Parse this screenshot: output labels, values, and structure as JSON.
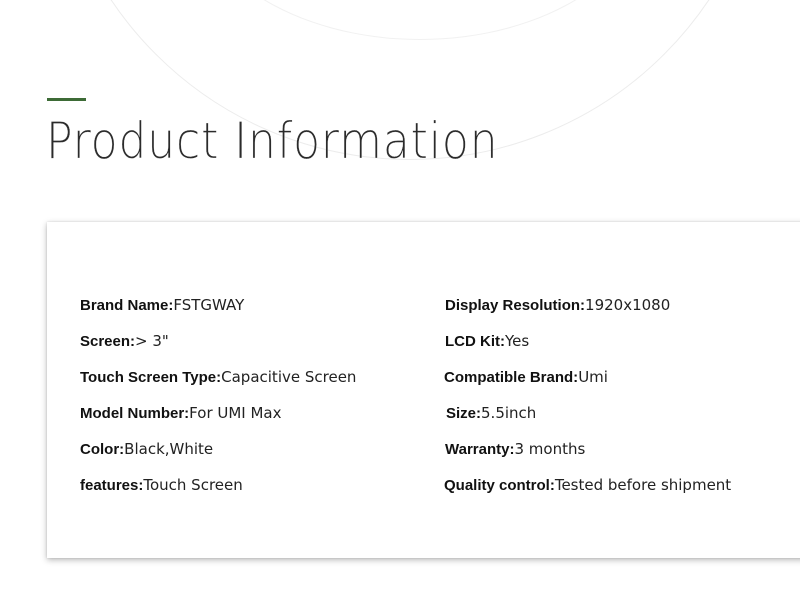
{
  "header": {
    "title": "Product Information",
    "accent_color": "#3d6b36"
  },
  "specs_left": [
    {
      "label": "Brand Name:",
      "value": "FSTGWAY"
    },
    {
      "label": "Screen:",
      "value": "> 3\""
    },
    {
      "label": "Touch Screen Type:",
      "value": "Capacitive Screen"
    },
    {
      "label": "Model Number:",
      "value": "For UMI Max"
    },
    {
      "label": "Color:",
      "value": "Black,White"
    },
    {
      "label": "features:",
      "value": "Touch Screen"
    }
  ],
  "specs_right": [
    {
      "label": "Display Resolution:",
      "value": "1920x1080"
    },
    {
      "label": "LCD Kit:",
      "value": "Yes"
    },
    {
      "label": "Compatible Brand:",
      "value": "Umi"
    },
    {
      "label": "Size:",
      "value": "5.5inch"
    },
    {
      "label": "Warranty:",
      "value": "3 months"
    },
    {
      "label": "Quality control:",
      "value": "Tested before shipment"
    }
  ]
}
